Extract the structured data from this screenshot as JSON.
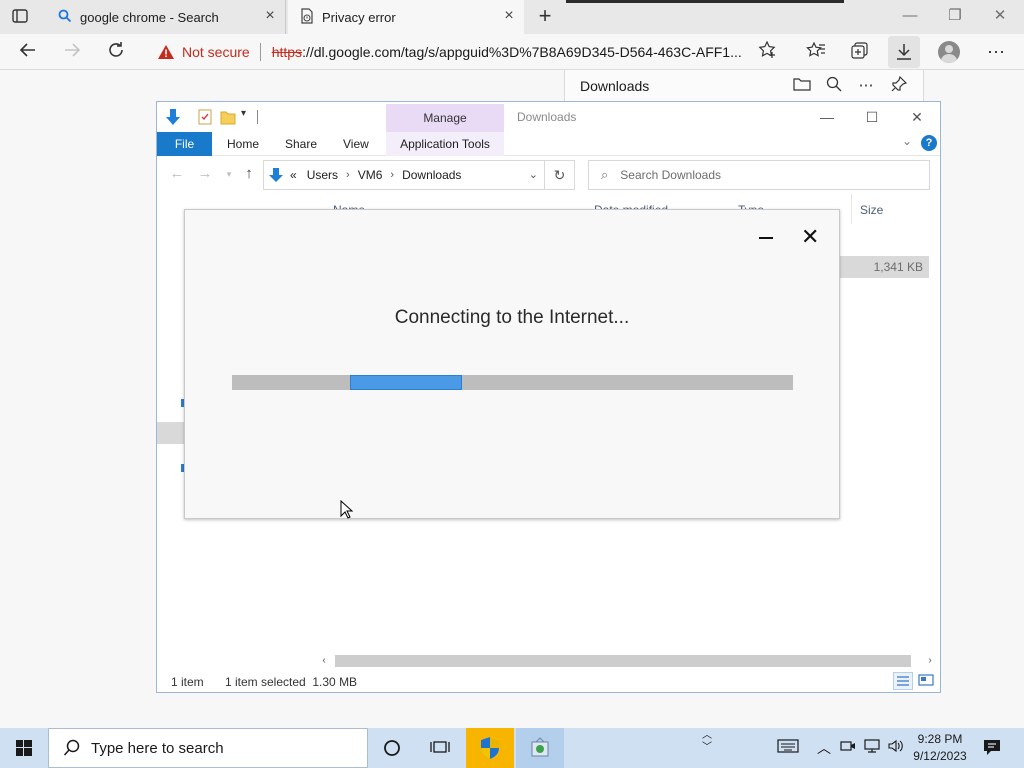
{
  "browser": {
    "tabs": [
      {
        "title": "google chrome - Search",
        "icon": "search-icon"
      },
      {
        "title": "Privacy error",
        "icon": "warning-page-icon"
      }
    ],
    "address": {
      "security_label": "Not secure",
      "url_scheme": "https",
      "url_rest": "://dl.google.com/tag/s/appguid%3D%7B8A69D345-D564-463C-AFF1..."
    },
    "downloads_panel": {
      "title": "Downloads"
    }
  },
  "explorer": {
    "window_title": "Downloads",
    "context_tab": "Manage",
    "ribbon_tabs": [
      "File",
      "Home",
      "Share",
      "View",
      "Application Tools"
    ],
    "breadcrumb": [
      "Users",
      "VM6",
      "Downloads"
    ],
    "breadcrumb_prefix": "«",
    "search_placeholder": "Search Downloads",
    "columns": {
      "name": "Name",
      "date_modified": "Date modified",
      "type": "Type",
      "size": "Size"
    },
    "selected_file_size": "1,341 KB",
    "status": {
      "items": "1 item",
      "selected": "1 item selected  1.30 MB"
    }
  },
  "installer": {
    "status_text": "Connecting to the Internet...",
    "progress_fraction": 0.2
  },
  "taskbar": {
    "search_placeholder": "Type here to search",
    "time": "9:28 PM",
    "date": "9/12/2023"
  },
  "colors": {
    "accent_blue": "#1979ca",
    "warning_red": "#c42b1c",
    "progress_fill": "#4a9ae6",
    "manage_tab": "#e9dbf6",
    "taskbar": "#cfe0f2"
  }
}
